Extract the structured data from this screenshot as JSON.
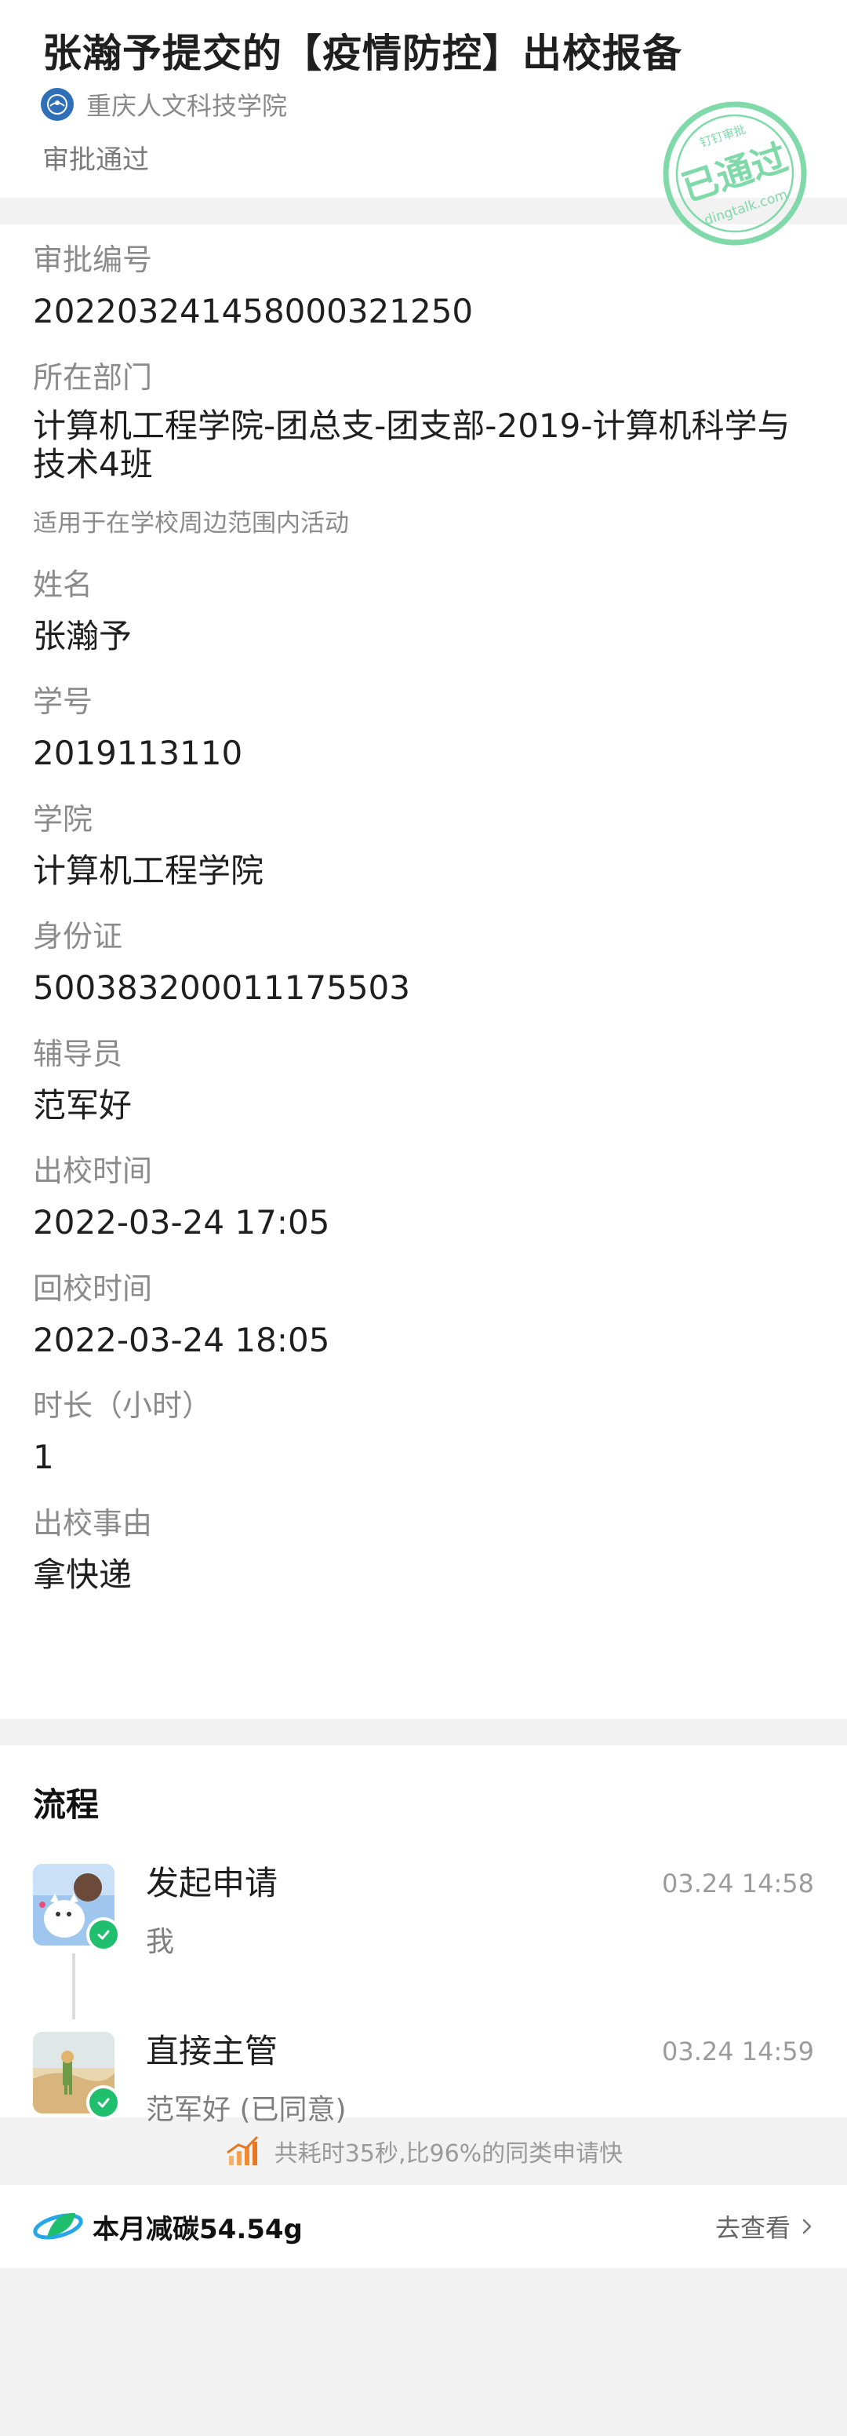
{
  "header": {
    "title": "张瀚予提交的【疫情防控】出校报备",
    "org_name": "重庆人文科技学院",
    "status": "审批通过",
    "stamp": {
      "main": "已通过",
      "top": "钉钉审批",
      "bottom": "dingtalk.com"
    }
  },
  "fields": [
    {
      "label": "审批编号",
      "value": "202203241458000321250"
    },
    {
      "label": "所在部门",
      "value": "计算机工程学院-团总支-团支部-2019-计算机科学与技术4班",
      "note": "适用于在学校周边范围内活动"
    },
    {
      "label": "姓名",
      "value": "张瀚予"
    },
    {
      "label": "学号",
      "value": "2019113110"
    },
    {
      "label": "学院",
      "value": "计算机工程学院"
    },
    {
      "label": "身份证",
      "value": "500383200011175503"
    },
    {
      "label": "辅导员",
      "value": "范军好"
    },
    {
      "label": "出校时间",
      "value": "2022-03-24 17:05"
    },
    {
      "label": "回校时间",
      "value": "2022-03-24 18:05"
    },
    {
      "label": "时长（小时）",
      "value": "1"
    },
    {
      "label": "出校事由",
      "value": "拿快递"
    }
  ],
  "flow": {
    "title": "流程",
    "steps": [
      {
        "name": "发起申请",
        "sub": "我",
        "time": "03.24 14:58"
      },
      {
        "name": "直接主管",
        "sub": "范军好 (已同意)",
        "time": "03.24 14:59"
      }
    ]
  },
  "perf": {
    "text": "共耗时35秒,比96%的同类申请快"
  },
  "carbon": {
    "text": "本月减碳54.54g",
    "link": "去查看"
  },
  "colors": {
    "accent_green": "#1fbf6e",
    "stamp_green": "#7fd9a8",
    "org_blue": "#2f6fb7"
  }
}
